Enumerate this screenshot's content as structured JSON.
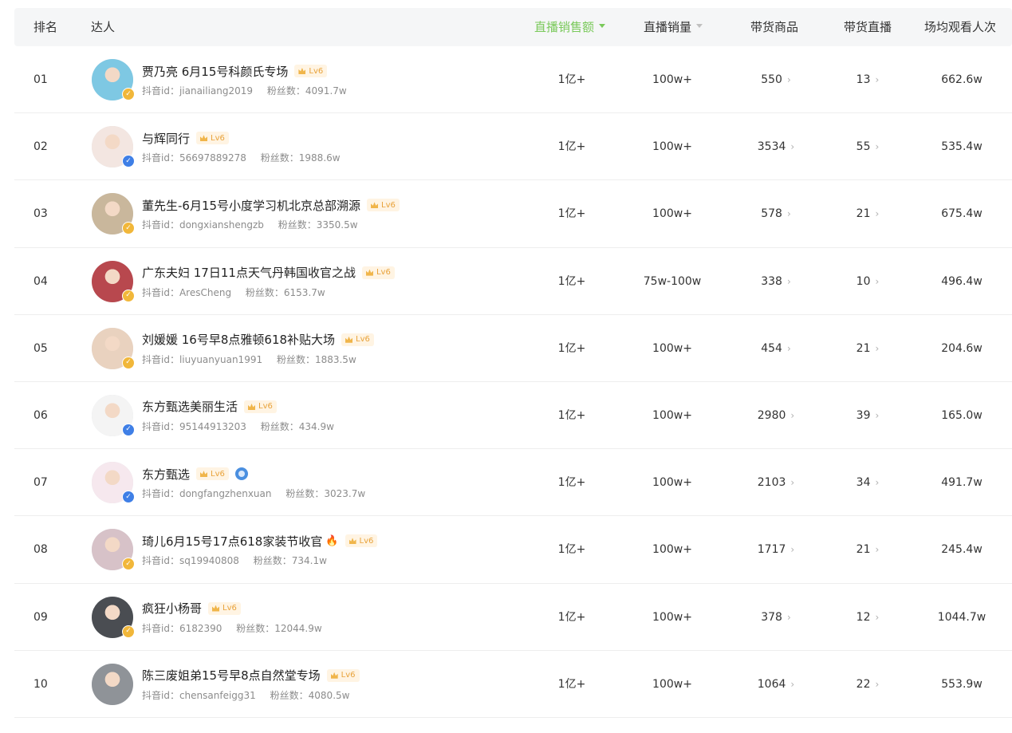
{
  "header": {
    "rank": "排名",
    "influencer": "达人",
    "live_sales_amount": "直播销售额",
    "live_sales_volume": "直播销量",
    "products": "带货商品",
    "lives": "带货直播",
    "avg_viewers": "场均观看人次"
  },
  "labels": {
    "douyin_id": "抖音id：",
    "fans": "粉丝数：",
    "level": "Lv6"
  },
  "rows": [
    {
      "rank": "01",
      "name": "贾乃亮 6月15号科颜氏专场",
      "id": "jianailiang2019",
      "fans": "4091.7w",
      "sales": "1亿+",
      "volume": "100w+",
      "goods": "550",
      "lives": "13",
      "viewers": "662.6w",
      "verify": "gold",
      "avatar_color": "#7ec8e3",
      "extra": ""
    },
    {
      "rank": "02",
      "name": "与辉同行",
      "id": "56697889278",
      "fans": "1988.6w",
      "sales": "1亿+",
      "volume": "100w+",
      "goods": "3534",
      "lives": "55",
      "viewers": "535.4w",
      "verify": "blue",
      "avatar_color": "#f3e6e1",
      "extra": ""
    },
    {
      "rank": "03",
      "name": "董先生-6月15号小度学习机北京总部溯源",
      "id": "dongxianshengzb",
      "fans": "3350.5w",
      "sales": "1亿+",
      "volume": "100w+",
      "goods": "578",
      "lives": "21",
      "viewers": "675.4w",
      "verify": "gold",
      "avatar_color": "#c9b79c",
      "extra": ""
    },
    {
      "rank": "04",
      "name": "广东夫妇 17日11点天气丹韩国收官之战",
      "id": "AresCheng",
      "fans": "6153.7w",
      "sales": "1亿+",
      "volume": "75w-100w",
      "goods": "338",
      "lives": "10",
      "viewers": "496.4w",
      "verify": "gold",
      "avatar_color": "#b8484e",
      "extra": ""
    },
    {
      "rank": "05",
      "name": "刘媛媛 16号早8点雅顿618补贴大场",
      "id": "liuyuanyuan1991",
      "fans": "1883.5w",
      "sales": "1亿+",
      "volume": "100w+",
      "goods": "454",
      "lives": "21",
      "viewers": "204.6w",
      "verify": "gold",
      "avatar_color": "#e9d2bf",
      "extra": ""
    },
    {
      "rank": "06",
      "name": "东方甄选美丽生活",
      "id": "95144913203",
      "fans": "434.9w",
      "sales": "1亿+",
      "volume": "100w+",
      "goods": "2980",
      "lives": "39",
      "viewers": "165.0w",
      "verify": "blue",
      "avatar_color": "#f4f4f4",
      "extra": ""
    },
    {
      "rank": "07",
      "name": "东方甄选",
      "id": "dongfangzhenxuan",
      "fans": "3023.7w",
      "sales": "1亿+",
      "volume": "100w+",
      "goods": "2103",
      "lives": "34",
      "viewers": "491.7w",
      "verify": "blue",
      "avatar_color": "#f6e8ee",
      "extra": "badge"
    },
    {
      "rank": "08",
      "name": "琦儿6月15号17点618家装节收官",
      "id": "sq19940808",
      "fans": "734.1w",
      "sales": "1亿+",
      "volume": "100w+",
      "goods": "1717",
      "lives": "21",
      "viewers": "245.4w",
      "verify": "gold",
      "avatar_color": "#d7c2c8",
      "extra": "fire"
    },
    {
      "rank": "09",
      "name": "疯狂小杨哥",
      "id": "6182390",
      "fans": "12044.9w",
      "sales": "1亿+",
      "volume": "100w+",
      "goods": "378",
      "lives": "12",
      "viewers": "1044.7w",
      "verify": "gold",
      "avatar_color": "#4a4d52",
      "extra": ""
    },
    {
      "rank": "10",
      "name": "陈三废姐弟15号早8点自然堂专场",
      "id": "chensanfeigg31",
      "fans": "4080.5w",
      "sales": "1亿+",
      "volume": "100w+",
      "goods": "1064",
      "lives": "22",
      "viewers": "553.9w",
      "verify": "",
      "avatar_color": "#8f9398",
      "extra": ""
    }
  ],
  "colors": {
    "accent": "#7ac95b",
    "header_bg": "#f5f6f7",
    "level_bg": "#fff4e3",
    "level_text": "#e8a23a"
  }
}
